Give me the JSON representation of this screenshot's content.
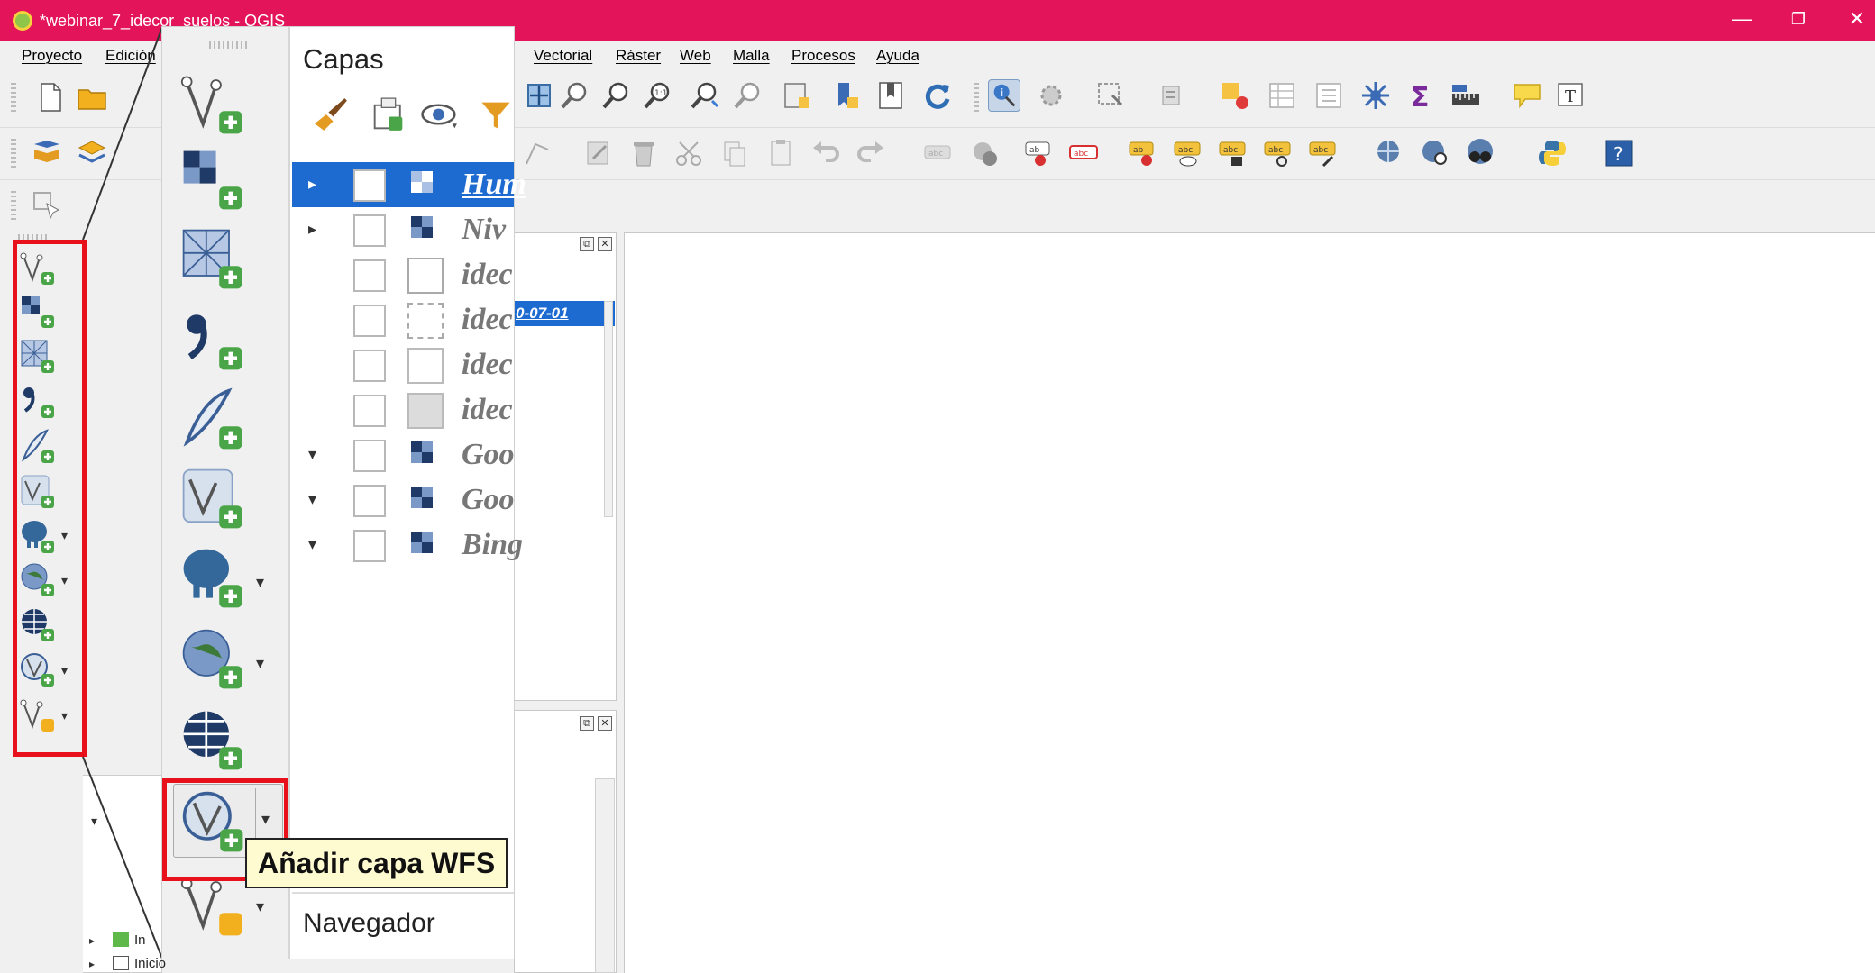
{
  "window": {
    "title": "*webinar_7_idecor_suelos - QGIS",
    "controls": {
      "minimize": "—",
      "restore": "❐",
      "close": "✕"
    }
  },
  "menu": {
    "items": [
      "Proyecto",
      "Edición",
      "Vectorial",
      "Ráster",
      "Web",
      "Malla",
      "Procesos",
      "Ayuda"
    ]
  },
  "left_toolbar": {
    "icons": [
      "add-vector-layer-icon",
      "add-raster-layer-icon",
      "add-mesh-layer-icon",
      "add-delimited-text-layer-icon",
      "new-gpx-layer-icon",
      "add-virtual-layer-icon",
      "add-postgis-layer-icon",
      "add-wms-layer-icon",
      "add-xyz-layer-icon",
      "add-wfs-layer-icon",
      "new-spatialite-layer-icon"
    ]
  },
  "zoom": {
    "layers_panel_title": "Capas",
    "browser_panel_title": "Navegador",
    "tooltip": "Añadir capa WFS",
    "layers": [
      {
        "name": "Hum",
        "expand": "▸",
        "selected": true
      },
      {
        "name": "Niv",
        "expand": "▸",
        "selected": false
      },
      {
        "name": "idec",
        "expand": "",
        "selected": false
      },
      {
        "name": "idec",
        "expand": "",
        "selected": false
      },
      {
        "name": "idec",
        "expand": "",
        "selected": false
      },
      {
        "name": "idec",
        "expand": "",
        "selected": false
      },
      {
        "name": "Goo",
        "expand": "▾",
        "selected": false
      },
      {
        "name": "Goo",
        "expand": "▾",
        "selected": false
      },
      {
        "name": "Bing",
        "expand": "▾",
        "selected": false
      }
    ]
  },
  "dock": {
    "date_value": "0-07-01",
    "browser_items": [
      "In",
      "Inicio"
    ]
  },
  "colors": {
    "title_bar": "#e4145b",
    "selection": "#1d6bd1",
    "highlight_box": "#e8101a"
  }
}
